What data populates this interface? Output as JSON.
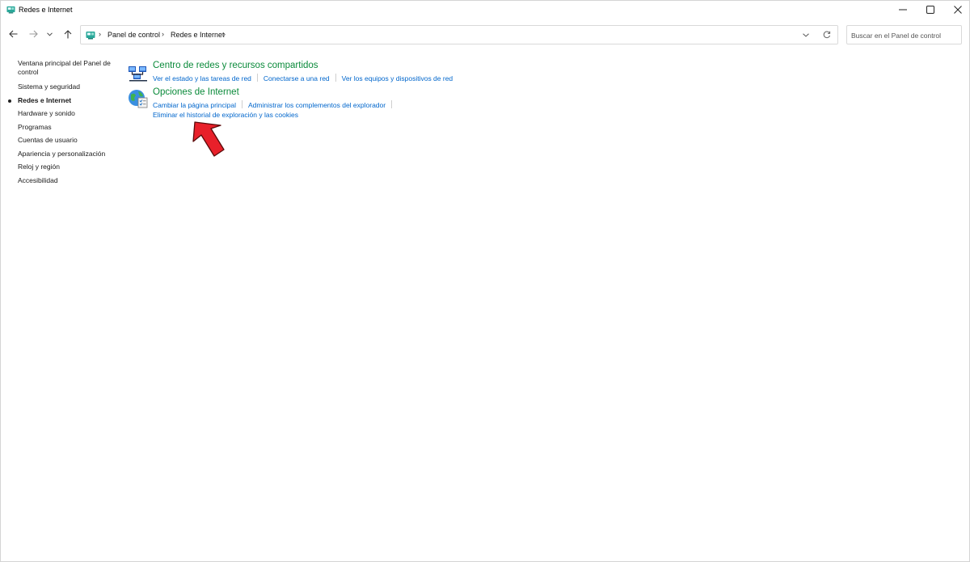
{
  "window": {
    "title": "Redes e Internet"
  },
  "address": {
    "crumbs": [
      "Panel de control",
      "Redes e Internet"
    ]
  },
  "search": {
    "placeholder": "Buscar en el Panel de control"
  },
  "sidebar": {
    "home": "Ventana principal del Panel de control",
    "items": [
      {
        "label": "Sistema y seguridad",
        "active": false
      },
      {
        "label": "Redes e Internet",
        "active": true
      },
      {
        "label": "Hardware y sonido",
        "active": false
      },
      {
        "label": "Programas",
        "active": false
      },
      {
        "label": "Cuentas de usuario",
        "active": false
      },
      {
        "label": "Apariencia y personalización",
        "active": false
      },
      {
        "label": "Reloj y región",
        "active": false
      },
      {
        "label": "Accesibilidad",
        "active": false
      }
    ]
  },
  "categories": [
    {
      "title": "Centro de redes y recursos compartidos",
      "icon": "network-sharing-icon",
      "links": [
        "Ver el estado y las tareas de red",
        "Conectarse a una red",
        "Ver los equipos y dispositivos de red"
      ]
    },
    {
      "title": "Opciones de Internet",
      "icon": "internet-options-icon",
      "links": [
        "Cambiar la página principal",
        "Administrar los complementos del explorador",
        "Eliminar el historial de exploración y las cookies"
      ]
    }
  ],
  "colors": {
    "category_title": "#0a8a3a",
    "link": "#0066cc",
    "annotation_arrow": "#e8202a"
  }
}
